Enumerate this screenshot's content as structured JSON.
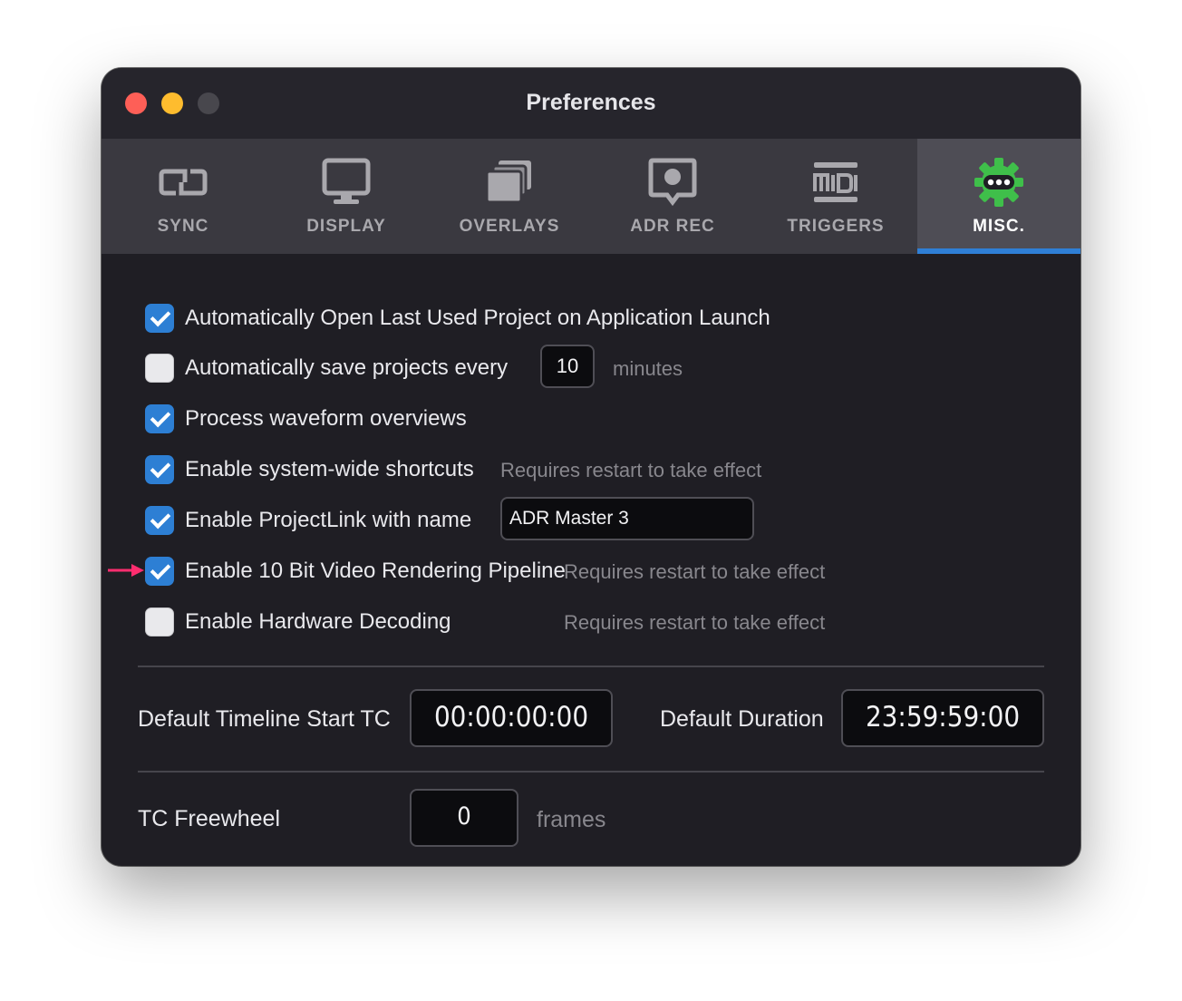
{
  "window": {
    "title": "Preferences"
  },
  "tabs": [
    {
      "label": "SYNC",
      "icon": "sync-icon"
    },
    {
      "label": "DISPLAY",
      "icon": "display-icon"
    },
    {
      "label": "OVERLAYS",
      "icon": "overlays-icon"
    },
    {
      "label": "ADR REC",
      "icon": "adr-rec-icon"
    },
    {
      "label": "TRIGGERS",
      "icon": "midi-icon"
    },
    {
      "label": "MISC.",
      "icon": "gear-icon",
      "active": true
    }
  ],
  "options": {
    "auto_open": {
      "label": "Automatically Open Last Used Project on Application Launch",
      "checked": true
    },
    "auto_save": {
      "label": "Automatically save projects every",
      "checked": false,
      "value": "10",
      "unit": "minutes"
    },
    "waveform": {
      "label": "Process waveform overviews",
      "checked": true
    },
    "shortcuts": {
      "label": "Enable system-wide shortcuts",
      "checked": true,
      "note": "Requires restart to take effect"
    },
    "projectlink": {
      "label": "Enable ProjectLink with name",
      "checked": true,
      "value": "ADR Master 3"
    },
    "ten_bit": {
      "label": "Enable 10 Bit Video Rendering Pipeline",
      "checked": true,
      "note": "Requires restart to take effect"
    },
    "hw_decoding": {
      "label": "Enable Hardware Decoding",
      "checked": false,
      "note": "Requires restart to take effect"
    }
  },
  "timecode": {
    "start_label": "Default Timeline Start TC",
    "start_value": "00:00:00:00",
    "duration_label": "Default Duration",
    "duration_value": "23:59:59:00"
  },
  "freewheel": {
    "label": "TC Freewheel",
    "value": "0",
    "unit": "frames"
  },
  "colors": {
    "accent": "#2d7fd4",
    "annotation_arrow": "#ff2d6f",
    "gear": "#3fbf4a"
  }
}
